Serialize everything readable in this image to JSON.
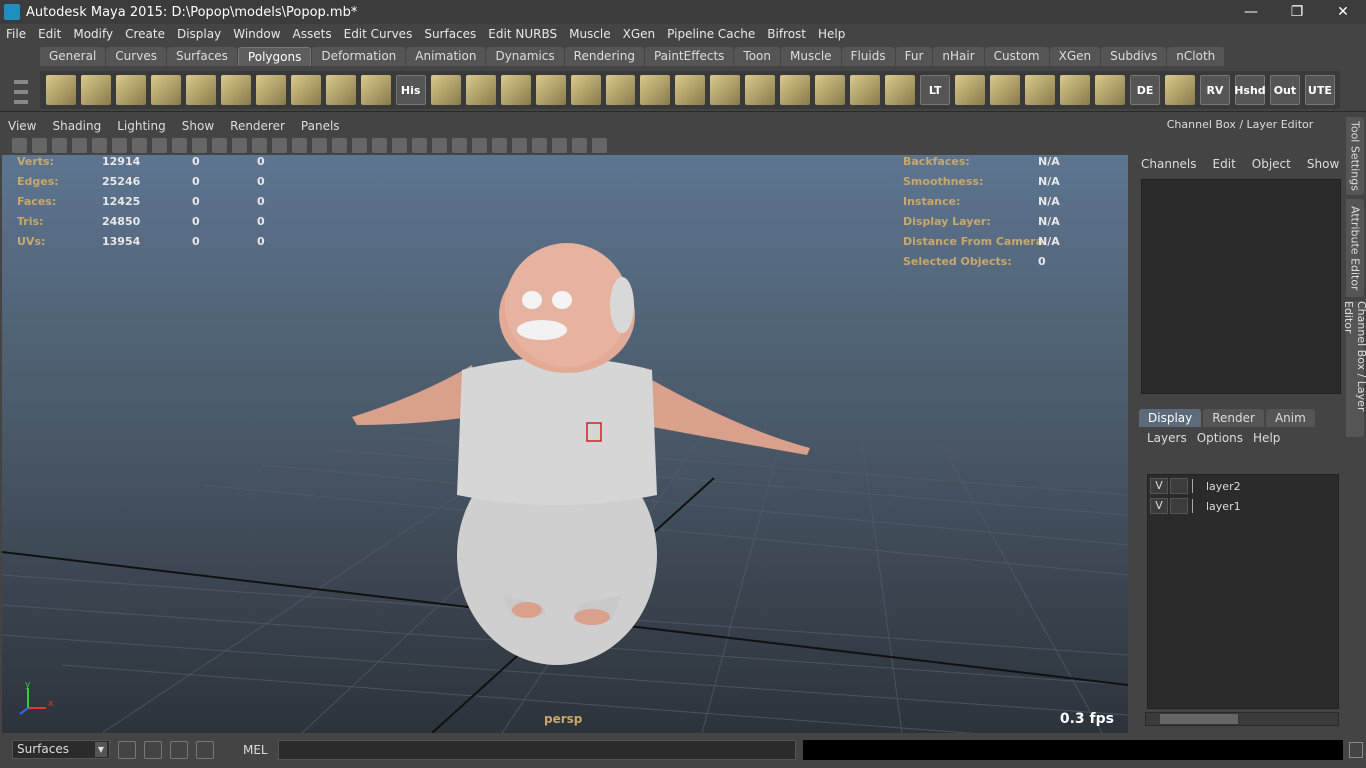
{
  "window": {
    "title": "Autodesk Maya 2015: D:\\Popop\\models\\Popop.mb*"
  },
  "menubar": [
    "File",
    "Edit",
    "Modify",
    "Create",
    "Display",
    "Window",
    "Assets",
    "Edit Curves",
    "Surfaces",
    "Edit NURBS",
    "Muscle",
    "XGen",
    "Pipeline Cache",
    "Bifrost",
    "Help"
  ],
  "shelf": {
    "tabs": [
      "General",
      "Curves",
      "Surfaces",
      "Polygons",
      "Deformation",
      "Animation",
      "Dynamics",
      "Rendering",
      "PaintEffects",
      "Toon",
      "Muscle",
      "Fluids",
      "Fur",
      "nHair",
      "Custom",
      "XGen",
      "Subdivs",
      "nCloth"
    ],
    "active_tab": "Polygons",
    "text_buttons": [
      "His",
      "LT",
      "DE",
      "RV",
      "Hshd",
      "Out",
      "UTE"
    ]
  },
  "panel_menu": [
    "View",
    "Shading",
    "Lighting",
    "Show",
    "Renderer",
    "Panels"
  ],
  "hud_left": [
    {
      "label": "Verts:",
      "values": [
        "12914",
        "0",
        "0"
      ]
    },
    {
      "label": "Edges:",
      "values": [
        "25246",
        "0",
        "0"
      ]
    },
    {
      "label": "Faces:",
      "values": [
        "12425",
        "0",
        "0"
      ]
    },
    {
      "label": "Tris:",
      "values": [
        "24850",
        "0",
        "0"
      ]
    },
    {
      "label": "UVs:",
      "values": [
        "13954",
        "0",
        "0"
      ]
    }
  ],
  "hud_right": [
    {
      "label": "Backfaces:",
      "value": "N/A"
    },
    {
      "label": "Smoothness:",
      "value": "N/A"
    },
    {
      "label": "Instance:",
      "value": "N/A"
    },
    {
      "label": "Display Layer:",
      "value": "N/A"
    },
    {
      "label": "Distance From Camera:",
      "value": "N/A"
    },
    {
      "label": "Selected Objects:",
      "value": "0"
    }
  ],
  "viewport": {
    "camera": "persp",
    "fps": "0.3 fps",
    "axis_x": "x",
    "axis_y": "y"
  },
  "channel_box": {
    "title": "Channel Box / Layer Editor",
    "menu": [
      "Channels",
      "Edit",
      "Object",
      "Show"
    ]
  },
  "layer_editor": {
    "tabs": [
      "Display",
      "Render",
      "Anim"
    ],
    "active_tab": "Display",
    "menu": [
      "Layers",
      "Options",
      "Help"
    ],
    "layers": [
      {
        "visible": "V",
        "name": "layer2"
      },
      {
        "visible": "V",
        "name": "layer1"
      }
    ]
  },
  "side_tabs": [
    "Tool Settings",
    "Attribute Editor",
    "Channel Box / Layer Editor"
  ],
  "command_line": {
    "mode": "Surfaces",
    "language": "MEL"
  }
}
